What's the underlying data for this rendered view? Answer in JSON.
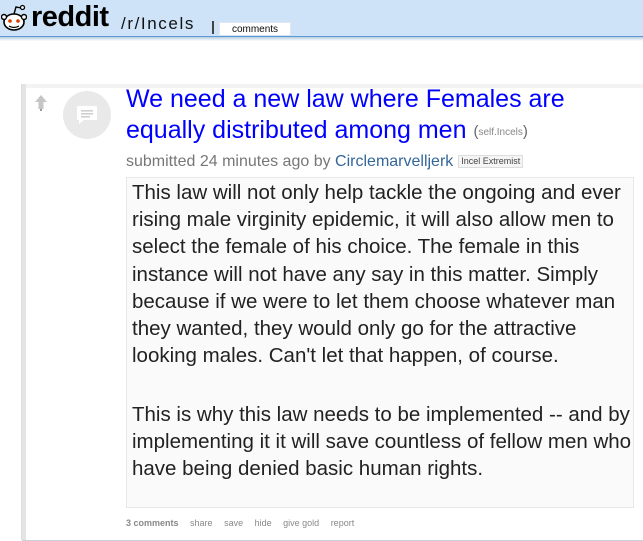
{
  "header": {
    "logo_text": "reddit",
    "subreddit": "/r/Incels",
    "tabs": [
      {
        "label": "comments",
        "active": true
      }
    ],
    "colors": {
      "bar": "#cee3f8",
      "border": "#5f99cf"
    }
  },
  "post": {
    "title": "We need a new law where Females are equally distributed among men",
    "domain": "self.Incels",
    "tagline": {
      "prefix": "submitted",
      "time": "24 minutes ago",
      "by": "by",
      "author": "Circlemarvelljerk",
      "flair": "Incel Extremist"
    },
    "body": [
      "This law will not only help tackle the ongoing and ever rising male virginity epidemic, it will also allow men to select the female of his choice. The female in this instance will not have any say in this matter. Simply because if we were to let them choose whatever man they wanted, they would only go for the attractive looking males. Can't let that happen, of course.",
      "This is why this law needs to be implemented -- and by implementing it it will save countless of fellow men who have being denied basic human rights."
    ],
    "buttons": {
      "comments": "3 comments",
      "share": "share",
      "save": "save",
      "hide": "hide",
      "give_gold": "give gold",
      "report": "report"
    },
    "icons": {
      "vote": "upvote-arrow-icon",
      "thumbnail": "self-post-icon"
    },
    "colors": {
      "title": "#0000ff",
      "author": "#336699",
      "meta": "#777777"
    }
  }
}
